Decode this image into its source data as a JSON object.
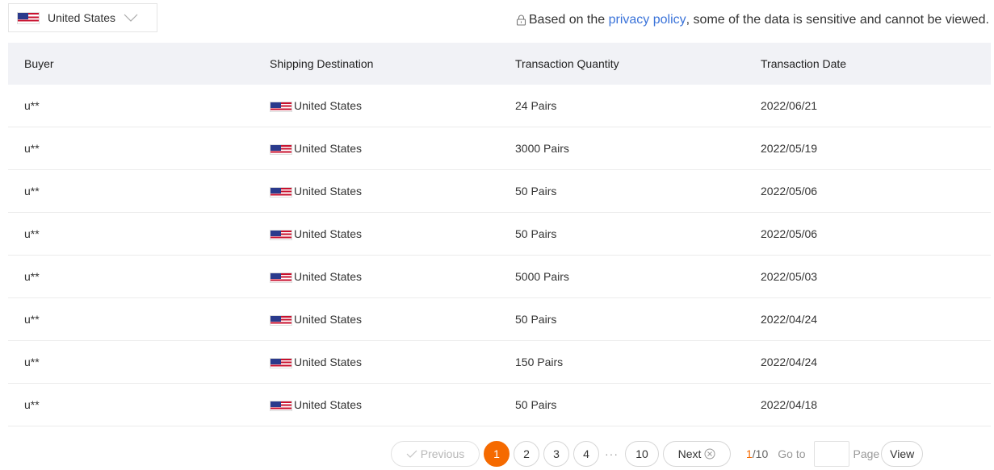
{
  "country_select": {
    "flag_icon": "us-flag-icon",
    "label": "United States",
    "chevron_icon": "chevron-down-icon"
  },
  "privacy_notice": {
    "lock_icon": "lock-icon",
    "prefix": "Based on the ",
    "link": "privacy policy",
    "suffix": ", some of the data is sensitive and cannot be viewed."
  },
  "table": {
    "headers": [
      "Buyer",
      "Shipping Destination",
      "Transaction Quantity",
      "Transaction Date"
    ],
    "rows": [
      {
        "buyer": "u**",
        "destination": "United States",
        "quantity": "24 Pairs",
        "date": "2022/06/21"
      },
      {
        "buyer": "u**",
        "destination": "United States",
        "quantity": "3000 Pairs",
        "date": "2022/05/19"
      },
      {
        "buyer": "u**",
        "destination": "United States",
        "quantity": "50 Pairs",
        "date": "2022/05/06"
      },
      {
        "buyer": "u**",
        "destination": "United States",
        "quantity": "50 Pairs",
        "date": "2022/05/06"
      },
      {
        "buyer": "u**",
        "destination": "United States",
        "quantity": "5000 Pairs",
        "date": "2022/05/03"
      },
      {
        "buyer": "u**",
        "destination": "United States",
        "quantity": "50 Pairs",
        "date": "2022/04/24"
      },
      {
        "buyer": "u**",
        "destination": "United States",
        "quantity": "150 Pairs",
        "date": "2022/04/24"
      },
      {
        "buyer": "u**",
        "destination": "United States",
        "quantity": "50 Pairs",
        "date": "2022/04/18"
      }
    ]
  },
  "pagination": {
    "previous": "Previous",
    "pages": [
      "1",
      "2",
      "3",
      "4"
    ],
    "ellipsis": "···",
    "last_page": "10",
    "next": "Next",
    "current": "1",
    "total": "/10",
    "goto_label": "Go to",
    "goto_value": "",
    "page_label": "Page",
    "view": "View",
    "accent_color": "#f56a00"
  }
}
